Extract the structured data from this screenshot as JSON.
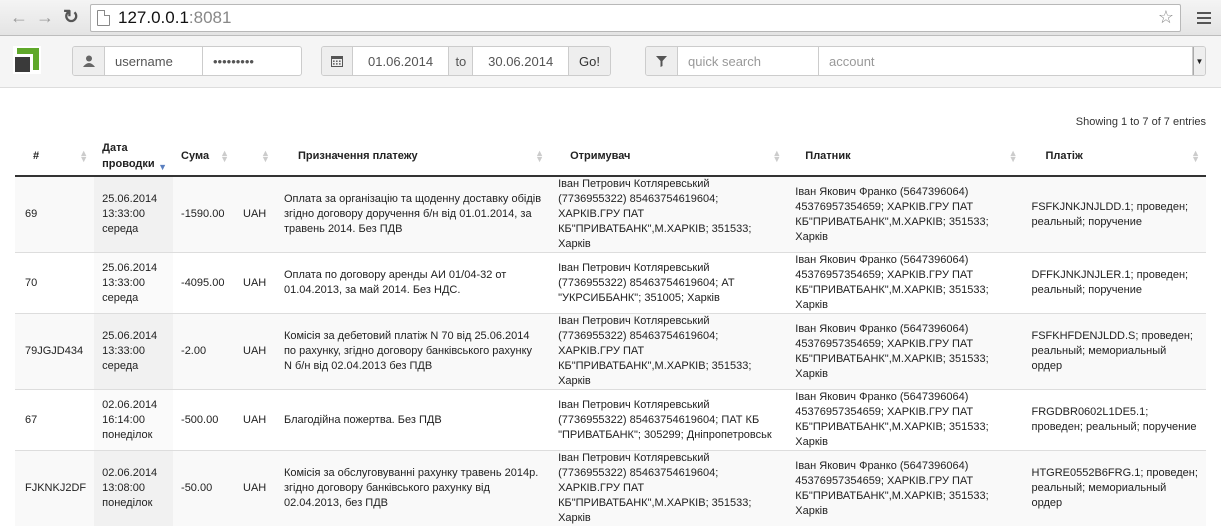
{
  "browser": {
    "url_host": "127.0.0.1",
    "url_port": ":8081"
  },
  "toolbar": {
    "username": "username",
    "password": "•••••••••",
    "date_from": "01.06.2014",
    "to_label": "to",
    "date_to": "30.06.2014",
    "go_label": "Go!",
    "search_placeholder": "quick search",
    "account_placeholder": "account"
  },
  "table": {
    "info": "Showing 1 to 7 of 7 entries",
    "columns": [
      "#",
      "Дата проводки",
      "Сума",
      "",
      "Призначення платежу",
      "Отримувач",
      "Платник",
      "Платіж"
    ],
    "sorted_column": "Дата проводки",
    "rows": [
      {
        "id": "69",
        "date": "25.06.2014",
        "time": "13:33:00",
        "weekday": "середа",
        "amount": "-1590.00",
        "currency": "UAH",
        "purpose": "Оплата за організацію та щоденну доставку обідів згідно договору доручення б/н від 01.01.2014, за травень 2014. Без ПДВ",
        "recipient": "Іван Петрович Котляревський (7736955322) 85463754619604; ХАРКІВ.ГРУ ПАТ КБ\"ПРИВАТБАНК\",М.ХАРКІВ; 351533; Харків",
        "payer": "Іван Якович Франко (5647396064) 45376957354659; ХАРКІВ.ГРУ ПАТ КБ\"ПРИВАТБАНК\",М.ХАРКІВ; 351533; Харків",
        "payment": "FSFKJNKJNJLDD.1; проведен; реальный; поручение"
      },
      {
        "id": "70",
        "date": "25.06.2014",
        "time": "13:33:00",
        "weekday": "середа",
        "amount": "-4095.00",
        "currency": "UAH",
        "purpose": "Оплата по договору аренды АИ 01/04-32 от 01.04.2013, за май 2014. Без НДС.",
        "recipient": "Іван Петрович Котляревський (7736955322) 85463754619604; АТ \"УКРСИББАНК\"; 351005; Харків",
        "payer": "Іван Якович Франко (5647396064) 45376957354659; ХАРКІВ.ГРУ ПАТ КБ\"ПРИВАТБАНК\",М.ХАРКІВ; 351533; Харків",
        "payment": "DFFKJNKJNJLER.1; проведен; реальный; поручение"
      },
      {
        "id": "79JGJD434",
        "date": "25.06.2014",
        "time": "13:33:00",
        "weekday": "середа",
        "amount": "-2.00",
        "currency": "UAH",
        "purpose": "Комісія за дебетовий платіж N 70 від 25.06.2014 по рахунку, згідно договору банківського рахунку N б/н від 02.04.2013 без ПДВ",
        "recipient": "Іван Петрович Котляревський (7736955322) 85463754619604; ХАРКІВ.ГРУ ПАТ КБ\"ПРИВАТБАНК\",М.ХАРКІВ; 351533; Харків",
        "payer": "Іван Якович Франко (5647396064) 45376957354659; ХАРКІВ.ГРУ ПАТ КБ\"ПРИВАТБАНК\",М.ХАРКІВ; 351533; Харків",
        "payment": "FSFKHFDENJLDD.S; проведен; реальный; мемориальный ордер"
      },
      {
        "id": "67",
        "date": "02.06.2014",
        "time": "16:14:00",
        "weekday": "понеділок",
        "amount": "-500.00",
        "currency": "UAH",
        "purpose": "Благодійна пожертва. Без ПДВ",
        "recipient": "Іван Петрович Котляревський (7736955322) 85463754619604; ПАТ КБ \"ПРИВАТБАНК\"; 305299; Дніпропетровськ",
        "payer": "Іван Якович Франко (5647396064) 45376957354659; ХАРКІВ.ГРУ ПАТ КБ\"ПРИВАТБАНК\",М.ХАРКІВ; 351533; Харків",
        "payment": "FRGDBR0602L1DE5.1; проведен; реальный; поручение"
      },
      {
        "id": "FJKNKJ2DF",
        "date": "02.06.2014",
        "time": "13:08:00",
        "weekday": "понеділок",
        "amount": "-50.00",
        "currency": "UAH",
        "purpose": "Комісія за обслуговуванні рахунку травень 2014р. згідно договору банківського рахунку від 02.04.2013, без ПДВ",
        "recipient": "Іван Петрович Котляревський (7736955322) 85463754619604; ХАРКІВ.ГРУ ПАТ КБ\"ПРИВАТБАНК\",М.ХАРКІВ; 351533; Харків",
        "payer": "Іван Якович Франко (5647396064) 45376957354659; ХАРКІВ.ГРУ ПАТ КБ\"ПРИВАТБАНК\",М.ХАРКІВ; 351533; Харків",
        "payment": "HTGRE0552B6FRG.1; проведен; реальный; мемориальный ордер"
      }
    ]
  }
}
